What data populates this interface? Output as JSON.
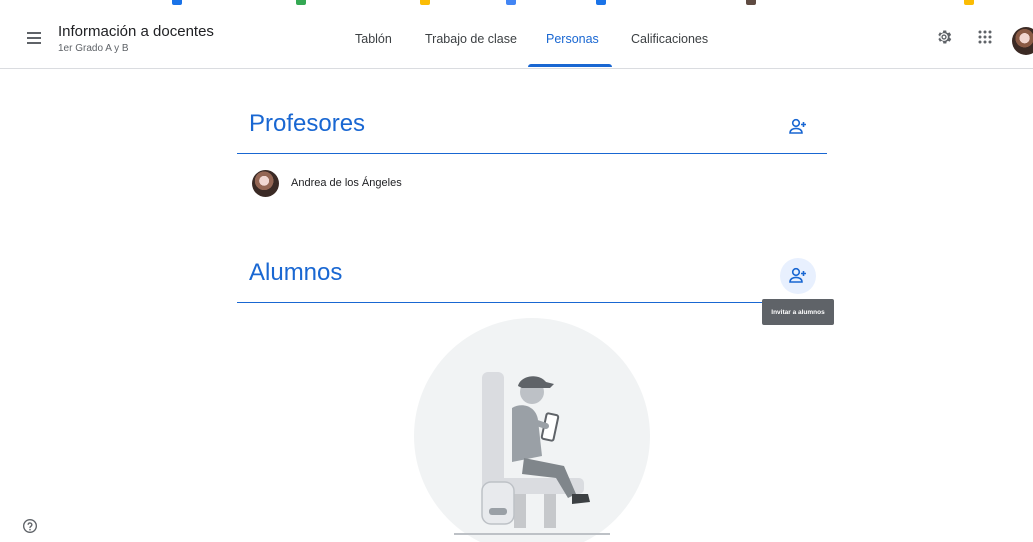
{
  "header": {
    "title": "Información a docentes",
    "subtitle": "1er Grado A y B",
    "tabs": [
      {
        "label": "Tablón",
        "active": false
      },
      {
        "label": "Trabajo de clase",
        "active": false
      },
      {
        "label": "Personas",
        "active": true
      },
      {
        "label": "Calificaciones",
        "active": false
      }
    ],
    "icons": [
      "menu-icon",
      "settings-icon",
      "apps-grid-icon",
      "account-avatar"
    ]
  },
  "teachers": {
    "heading": "Profesores",
    "add_icon": "person-add-icon",
    "people": [
      {
        "name": "Andrea de los Ángeles"
      }
    ]
  },
  "students": {
    "heading": "Alumnos",
    "add_icon": "person-add-icon",
    "tooltip": "Invitar a alumnos"
  },
  "footer": {
    "help_icon": "help-icon"
  },
  "colors": {
    "accent": "#1967d2",
    "tooltip_bg": "#5f6368",
    "illustration_bg": "#f1f3f4"
  }
}
